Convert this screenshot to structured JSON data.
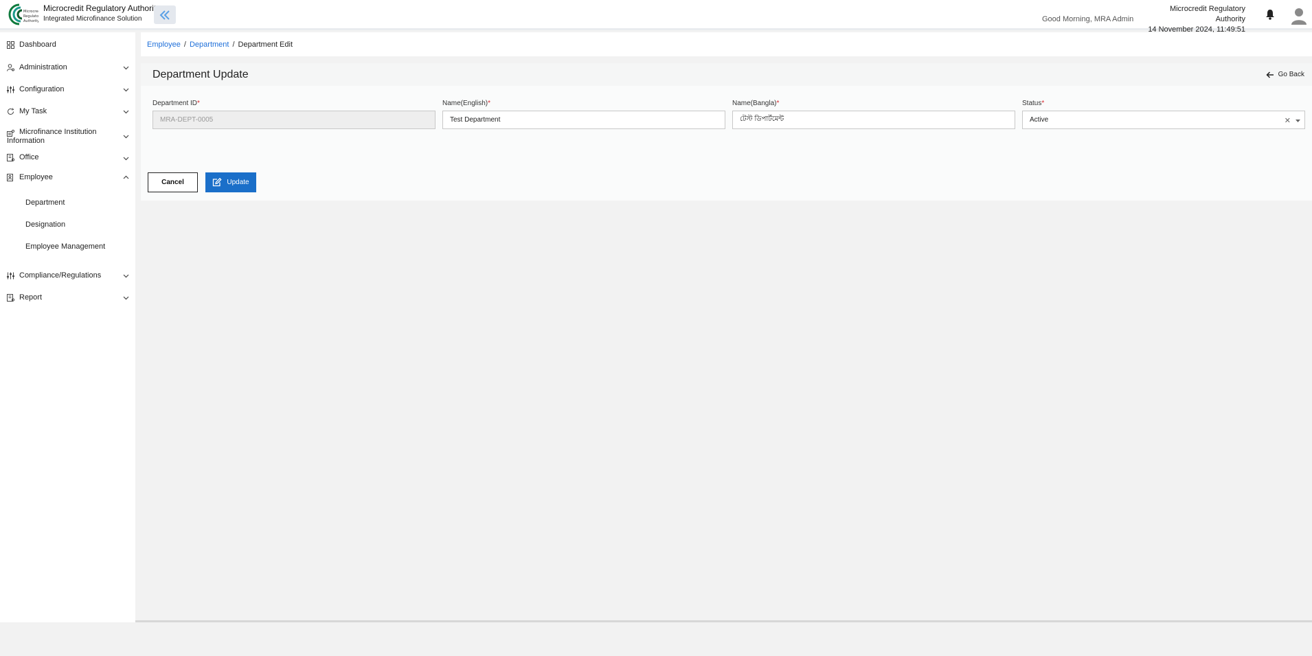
{
  "header": {
    "brand_title": "Microcredit Regulatory Authority",
    "brand_subtitle": "Integrated Microfinance Solution",
    "logo_text": "Microcredit Regulatory Authority",
    "greeting": "Good Morning, MRA Admin",
    "org_name": "Microcredit Regulatory Authority",
    "datetime": "14 November 2024, 11:49:51 AM",
    "accent_color": "#1a6fc9"
  },
  "sidebar": {
    "items": [
      {
        "label": "Dashboard",
        "icon": "grid-icon"
      },
      {
        "label": "Administration",
        "icon": "user-cog-icon"
      },
      {
        "label": "Configuration",
        "icon": "sliders-icon"
      },
      {
        "label": "My Task",
        "icon": "task-icon"
      },
      {
        "label": "Microfinance Institution Information",
        "icon": "institution-icon"
      },
      {
        "label": "Office",
        "icon": "office-icon"
      },
      {
        "label": "Employee",
        "icon": "employee-icon"
      },
      {
        "label": "Compliance/Regulations",
        "icon": "sliders-icon"
      },
      {
        "label": "Report",
        "icon": "report-icon"
      }
    ],
    "employee_sub": [
      "Department",
      "Designation",
      "Employee Management"
    ]
  },
  "breadcrumb": {
    "items": [
      "Employee",
      "Department"
    ],
    "current": "Department Edit"
  },
  "form": {
    "title": "Department Update",
    "go_back": "Go Back",
    "fields": {
      "dept_id": {
        "label": "Department ID",
        "value": "MRA-DEPT-0005"
      },
      "name_en": {
        "label": "Name(English)",
        "value": "Test Department"
      },
      "name_bn": {
        "label": "Name(Bangla)",
        "value": "টেস্ট ডিপার্টমেন্ট"
      },
      "status": {
        "label": "Status",
        "value": "Active"
      }
    },
    "required_mark": "*",
    "cancel_label": "Cancel",
    "update_label": "Update"
  }
}
